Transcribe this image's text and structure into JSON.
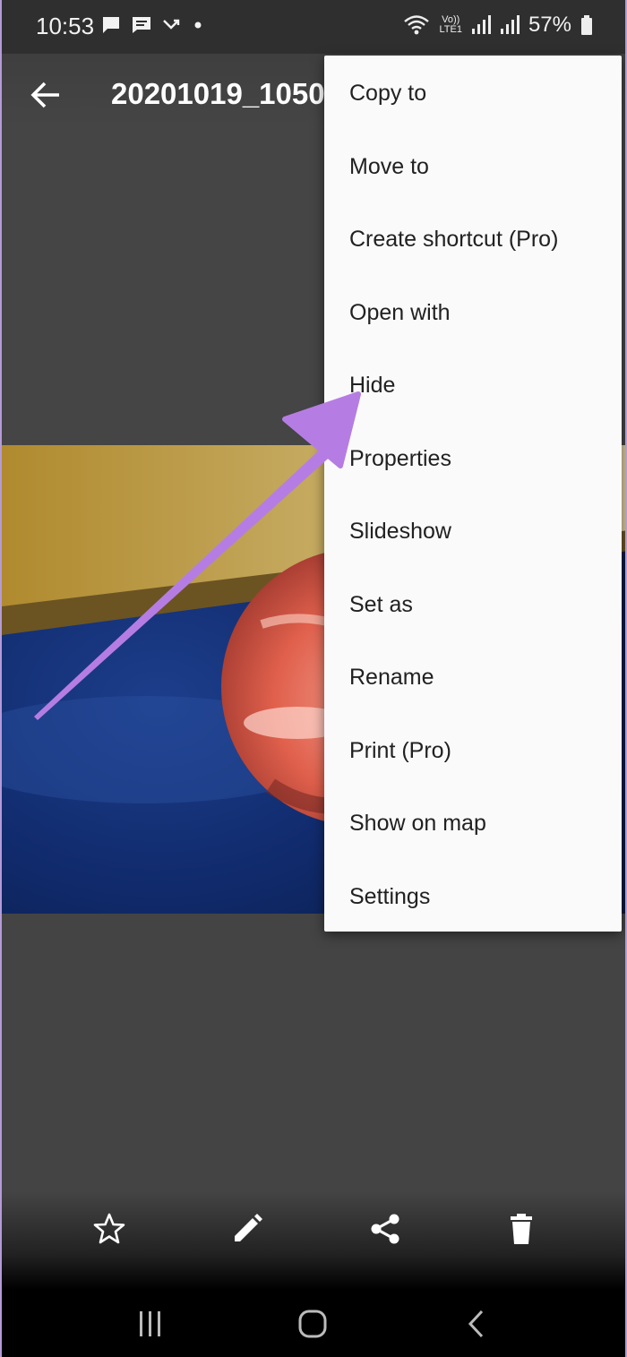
{
  "status_bar": {
    "time": "10:53",
    "network_label_top": "Vo))",
    "network_label_bottom": "LTE1",
    "battery": "57%",
    "icons": [
      "message-icon",
      "chat-icon",
      "missed-call-icon",
      "dot-icon",
      "wifi-icon",
      "signal-icon",
      "battery-icon"
    ]
  },
  "toolbar": {
    "title": "20201019_1050",
    "back_icon": "arrow-left-icon"
  },
  "menu": {
    "items": [
      "Copy to",
      "Move to",
      "Create shortcut (Pro)",
      "Open with",
      "Hide",
      "Properties",
      "Slideshow",
      "Set as",
      "Rename",
      "Print (Pro)",
      "Show on map",
      "Settings"
    ]
  },
  "annotation": {
    "color": "#b57de3"
  },
  "bottom_actions": [
    "star-icon",
    "edit-icon",
    "share-icon",
    "delete-icon"
  ],
  "nav_bar": [
    "recents-icon",
    "home-icon",
    "back-icon"
  ]
}
